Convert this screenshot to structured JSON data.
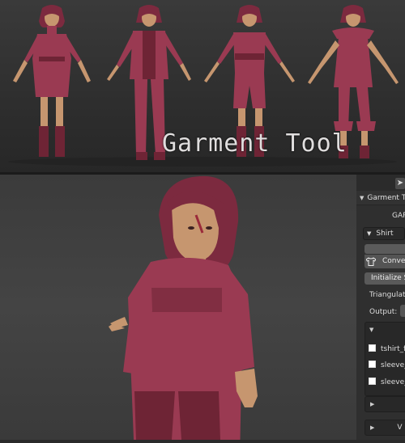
{
  "banner": {
    "title": "Garment Tool"
  },
  "panel": {
    "title": "Garment To",
    "section_label": "GAR",
    "garment_type": "Shirt",
    "convert_button": "Convert",
    "init_button": "Initialize Si",
    "triangulation_label": "Triangulation",
    "output_label": "Output:",
    "pieces": [
      "tshirt_fr",
      "sleeve_",
      "sleeve_"
    ],
    "collapsed_2_label": "V"
  },
  "colors": {
    "garment": "#9a3a52",
    "panel_bg": "#2f2f2f",
    "viewport_bg": "#3b3b3b"
  }
}
